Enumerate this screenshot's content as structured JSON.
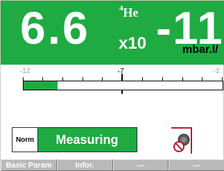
{
  "reading": {
    "mantissa": "6.6",
    "multiplier": "x10",
    "gas_mass": "4",
    "gas_symbol": "He",
    "exponent": "-11",
    "unit": "mbar.l/"
  },
  "scale": {
    "left_label": "12",
    "mid_label": "7",
    "right_label": "2",
    "fill_fraction": 0.17
  },
  "status": {
    "mode": "Norm",
    "text": "Measuring"
  },
  "valve": {
    "icon": "valve-closed-icon"
  },
  "softkeys": [
    "Basic Param",
    "Infor.",
    "---",
    "---"
  ],
  "colors": {
    "accent_green": "#1faa42",
    "valve_red": "#b11a2b",
    "softkey_gray": "#b9b9b9"
  }
}
